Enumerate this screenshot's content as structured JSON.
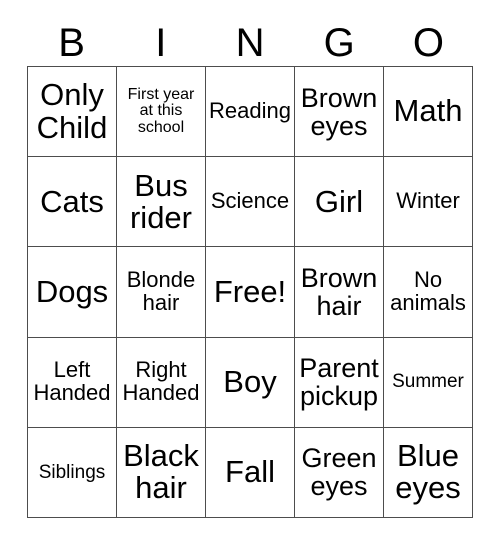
{
  "card": {
    "type": "bingo-card",
    "columns": 5,
    "rows": 5,
    "header": {
      "letters": [
        "B",
        "I",
        "N",
        "G",
        "O"
      ]
    },
    "colors": {
      "background": "#ffffff",
      "text": "#000000",
      "border": "#4d4d4d"
    },
    "grid": [
      [
        {
          "label": "Only\nChild",
          "size": "size-xl",
          "free": false
        },
        {
          "label": "First year\nat this\nschool",
          "size": "size-xs",
          "free": false
        },
        {
          "label": "Reading",
          "size": "size-md",
          "free": false
        },
        {
          "label": "Brown\neyes",
          "size": "size-lg",
          "free": false
        },
        {
          "label": "Math",
          "size": "size-xl",
          "free": false
        }
      ],
      [
        {
          "label": "Cats",
          "size": "size-xl",
          "free": false
        },
        {
          "label": "Bus\nrider",
          "size": "size-xl",
          "free": false
        },
        {
          "label": "Science",
          "size": "size-md",
          "free": false
        },
        {
          "label": "Girl",
          "size": "size-xl",
          "free": false
        },
        {
          "label": "Winter",
          "size": "size-md",
          "free": false
        }
      ],
      [
        {
          "label": "Dogs",
          "size": "size-xl",
          "free": false
        },
        {
          "label": "Blonde\nhair",
          "size": "size-md",
          "free": false
        },
        {
          "label": "Free!",
          "size": "size-xl",
          "free": true
        },
        {
          "label": "Brown\nhair",
          "size": "size-lg",
          "free": false
        },
        {
          "label": "No\nanimals",
          "size": "size-md",
          "free": false
        }
      ],
      [
        {
          "label": "Left\nHanded",
          "size": "size-md",
          "free": false
        },
        {
          "label": "Right\nHanded",
          "size": "size-md",
          "free": false
        },
        {
          "label": "Boy",
          "size": "size-xl",
          "free": false
        },
        {
          "label": "Parent\npickup",
          "size": "size-lg",
          "free": false
        },
        {
          "label": "Summer",
          "size": "size-sm",
          "free": false
        }
      ],
      [
        {
          "label": "Siblings",
          "size": "size-sm",
          "free": false
        },
        {
          "label": "Black\nhair",
          "size": "size-xl",
          "free": false
        },
        {
          "label": "Fall",
          "size": "size-xl",
          "free": false
        },
        {
          "label": "Green\neyes",
          "size": "size-lg",
          "free": false
        },
        {
          "label": "Blue\neyes",
          "size": "size-xl",
          "free": false
        }
      ]
    ]
  }
}
